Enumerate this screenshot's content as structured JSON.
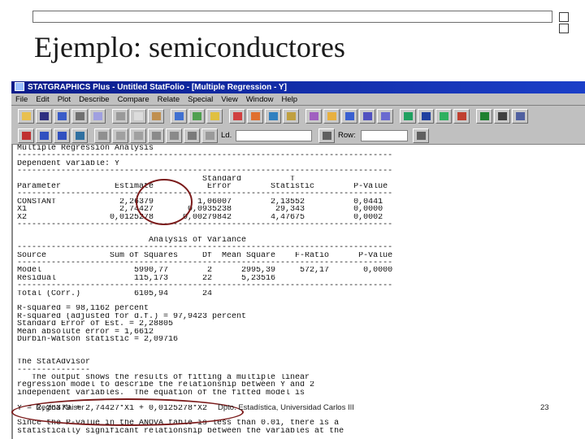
{
  "slide": {
    "title": "Ejemplo: semiconductores",
    "footer_left": "Regina Kaiser",
    "footer_center": "Dpto. Estadística, Universidad Carlos III",
    "footer_right": "23"
  },
  "app": {
    "window_title": "STATGRAPHICS Plus - Untitled StatFolio - [Multiple Regression - Y]",
    "menu": [
      "File",
      "Edit",
      "Plot",
      "Describe",
      "Compare",
      "Relate",
      "Special",
      "View",
      "Window",
      "Help"
    ],
    "toolbar_label_1": "Ld.",
    "toolbar_label_2": "Row:"
  },
  "output_lines": [
    "Multiple Regression Analysis",
    "-----------------------------------------------------------------------------",
    "Dependent variable: Y",
    "-----------------------------------------------------------------------------",
    "                                      Standard          T",
    "Parameter           Estimate           Error        Statistic        P-Value",
    "-----------------------------------------------------------------------------",
    "CONSTANT             2,26379         1,06007        2,13552          0,0441",
    "X1                   2,74427       0,0935238         29,343          0,0000",
    "X2                 0,0125278      0,00279842        4,47675          0,0002",
    "-----------------------------------------------------------------------------",
    "",
    "                           Analysis of Variance",
    "-----------------------------------------------------------------------------",
    "Source             Sum of Squares     Df  Mean Square    F-Ratio      P-Value",
    "-----------------------------------------------------------------------------",
    "Model                   5990,77        2      2995,39     572,17       0,0000",
    "Residual                115,173       22      5,23516",
    "-----------------------------------------------------------------------------",
    "Total (Corr.)           6105,94       24",
    "",
    "R-squared = 98,1162 percent",
    "R-squared (adjusted for d.f.) = 97,9423 percent",
    "Standard Error of Est. = 2,28805",
    "Mean absolute error = 1,6612",
    "Durbin-Watson statistic = 2,09716",
    "",
    "",
    "The StatAdvisor",
    "---------------",
    "   The output shows the results of fitting a multiple linear",
    "regression model to describe the relationship between Y and 2",
    "independent variables.  The equation of the fitted model is",
    "",
    "Y = 2,26379 + 2,74427*X1 + 0,0125278*X2",
    "",
    "Since the P-value in the ANOVA table is less than 0.01, there is a",
    "statistically significant relationship between the variables at the"
  ]
}
